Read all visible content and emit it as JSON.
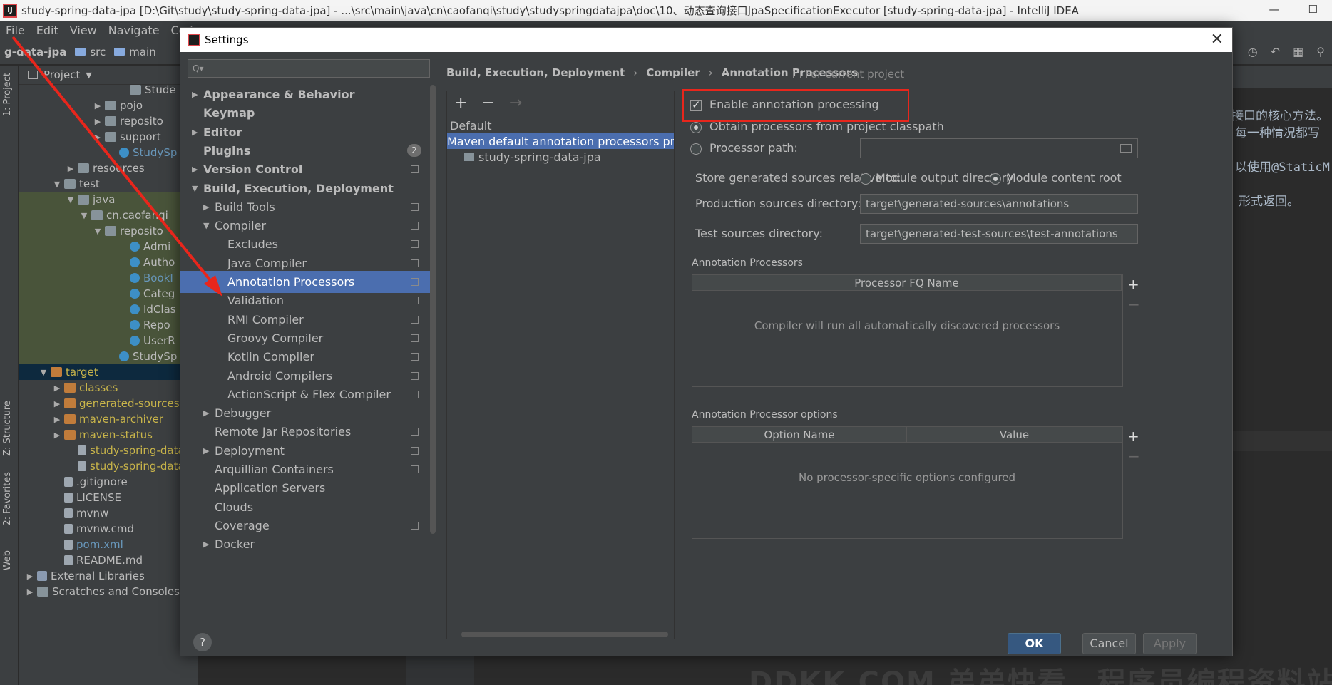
{
  "window": {
    "title": "study-spring-data-jpa [D:\\Git\\study\\study-spring-data-jpa] - ...\\src\\main\\java\\cn\\caofanqi\\study\\studyspringdatajpa\\doc\\10、动态查询接口JpaSpecificationExecutor [study-spring-data-jpa] - IntelliJ IDEA"
  },
  "menu": [
    "File",
    "Edit",
    "View",
    "Navigate",
    "Cod"
  ],
  "navbar": {
    "project": "g-data-jpa",
    "crumbs": [
      "src",
      "main"
    ]
  },
  "left_tools": [
    "1: Project",
    "Z: Structure",
    "2: Favorites",
    "Web"
  ],
  "project_panel": {
    "title": "Project",
    "rows": [
      {
        "label": "Stude",
        "indent": 130,
        "icon": "folder",
        "arrow": ""
      },
      {
        "label": "pojo",
        "indent": 95,
        "icon": "folder",
        "arrow": "▶"
      },
      {
        "label": "reposito",
        "indent": 95,
        "icon": "folder",
        "arrow": "▶"
      },
      {
        "label": "support",
        "indent": 95,
        "icon": "folder",
        "arrow": "▶"
      },
      {
        "label": "StudySp",
        "indent": 115,
        "icon": "jcls",
        "arrow": "",
        "style": "blue"
      },
      {
        "label": "resources",
        "indent": 57,
        "icon": "folder",
        "arrow": "▶"
      },
      {
        "label": "test",
        "indent": 38,
        "icon": "folder",
        "arrow": "▼"
      },
      {
        "label": "java",
        "indent": 57,
        "icon": "folder",
        "arrow": "▼",
        "style": "green"
      },
      {
        "label": "cn.caofanqi",
        "indent": 76,
        "icon": "folder",
        "arrow": "▼",
        "style": "green"
      },
      {
        "label": "reposito",
        "indent": 95,
        "icon": "folder",
        "arrow": "▼",
        "style": "green"
      },
      {
        "label": "Admi",
        "indent": 130,
        "icon": "jcls",
        "arrow": "",
        "style": "green"
      },
      {
        "label": "Autho",
        "indent": 130,
        "icon": "jcls",
        "arrow": "",
        "style": "green"
      },
      {
        "label": "BookI",
        "indent": 130,
        "icon": "jcls",
        "arrow": "",
        "style": "greenblue"
      },
      {
        "label": "Categ",
        "indent": 130,
        "icon": "jcls",
        "arrow": "",
        "style": "green"
      },
      {
        "label": "IdClas",
        "indent": 130,
        "icon": "jcls",
        "arrow": "",
        "style": "green"
      },
      {
        "label": "Repo",
        "indent": 130,
        "icon": "jcls",
        "arrow": "",
        "style": "green"
      },
      {
        "label": "UserR",
        "indent": 130,
        "icon": "jcls",
        "arrow": "",
        "style": "green"
      },
      {
        "label": "StudySp",
        "indent": 115,
        "icon": "jcls",
        "arrow": "",
        "style": "green"
      },
      {
        "label": "target",
        "indent": 19,
        "icon": "ofolder",
        "arrow": "▼",
        "style": "sel"
      },
      {
        "label": "classes",
        "indent": 38,
        "icon": "ofolder",
        "arrow": "▶",
        "style": "yellow"
      },
      {
        "label": "generated-sources",
        "indent": 38,
        "icon": "ofolder",
        "arrow": "▶",
        "style": "yellow"
      },
      {
        "label": "maven-archiver",
        "indent": 38,
        "icon": "ofolder",
        "arrow": "▶",
        "style": "yellow"
      },
      {
        "label": "maven-status",
        "indent": 38,
        "icon": "ofolder",
        "arrow": "▶",
        "style": "yellow"
      },
      {
        "label": "study-spring-data",
        "indent": 57,
        "icon": "file",
        "arrow": "",
        "style": "yellow"
      },
      {
        "label": "study-spring-data",
        "indent": 57,
        "icon": "file",
        "arrow": "",
        "style": "yellow"
      },
      {
        "label": ".gitignore",
        "indent": 38,
        "icon": "file",
        "arrow": ""
      },
      {
        "label": "LICENSE",
        "indent": 38,
        "icon": "file",
        "arrow": ""
      },
      {
        "label": "mvnw",
        "indent": 38,
        "icon": "file",
        "arrow": ""
      },
      {
        "label": "mvnw.cmd",
        "indent": 38,
        "icon": "file",
        "arrow": ""
      },
      {
        "label": "pom.xml",
        "indent": 38,
        "icon": "file",
        "arrow": "",
        "style": "blue"
      },
      {
        "label": "README.md",
        "indent": 38,
        "icon": "file",
        "arrow": ""
      },
      {
        "label": "External Libraries",
        "indent": 0,
        "icon": "lib",
        "arrow": "▶"
      },
      {
        "label": "Scratches and Consoles",
        "indent": 0,
        "icon": "folder",
        "arrow": "▶"
      }
    ]
  },
  "editor_text": [
    "接口的核心方法。",
    "每一种情况都写",
    "以使用@StaticM",
    "形式返回。"
  ],
  "watermark": "DDKK.COM 弟弟快看，程序员编程资料站",
  "dialog": {
    "title": "Settings",
    "search_placeholder": "Q▾",
    "nav": [
      {
        "label": "Appearance & Behavior",
        "level": 0,
        "arrow": "▶",
        "bold": true
      },
      {
        "label": "Keymap",
        "level": 0,
        "arrow": "",
        "bold": true
      },
      {
        "label": "Editor",
        "level": 0,
        "arrow": "▶",
        "bold": true
      },
      {
        "label": "Plugins",
        "level": 0,
        "arrow": "",
        "bold": true,
        "badge": "2"
      },
      {
        "label": "Version Control",
        "level": 0,
        "arrow": "▶",
        "bold": true,
        "copy": true
      },
      {
        "label": "Build, Execution, Deployment",
        "level": 0,
        "arrow": "▼",
        "bold": true
      },
      {
        "label": "Build Tools",
        "level": 1,
        "arrow": "▶",
        "copy": true
      },
      {
        "label": "Compiler",
        "level": 1,
        "arrow": "▼",
        "copy": true
      },
      {
        "label": "Excludes",
        "level": 2,
        "arrow": "",
        "copy": true
      },
      {
        "label": "Java Compiler",
        "level": 2,
        "arrow": "",
        "copy": true
      },
      {
        "label": "Annotation Processors",
        "level": 2,
        "arrow": "",
        "copy": true,
        "selected": true
      },
      {
        "label": "Validation",
        "level": 2,
        "arrow": "",
        "copy": true
      },
      {
        "label": "RMI Compiler",
        "level": 2,
        "arrow": "",
        "copy": true
      },
      {
        "label": "Groovy Compiler",
        "level": 2,
        "arrow": "",
        "copy": true
      },
      {
        "label": "Kotlin Compiler",
        "level": 2,
        "arrow": "",
        "copy": true
      },
      {
        "label": "Android Compilers",
        "level": 2,
        "arrow": "",
        "copy": true
      },
      {
        "label": "ActionScript & Flex Compiler",
        "level": 2,
        "arrow": "",
        "copy": true
      },
      {
        "label": "Debugger",
        "level": 1,
        "arrow": "▶"
      },
      {
        "label": "Remote Jar Repositories",
        "level": 1,
        "arrow": "",
        "copy": true
      },
      {
        "label": "Deployment",
        "level": 1,
        "arrow": "▶",
        "copy": true
      },
      {
        "label": "Arquillian Containers",
        "level": 1,
        "arrow": "",
        "copy": true
      },
      {
        "label": "Application Servers",
        "level": 1,
        "arrow": ""
      },
      {
        "label": "Clouds",
        "level": 1,
        "arrow": ""
      },
      {
        "label": "Coverage",
        "level": 1,
        "arrow": "",
        "copy": true
      },
      {
        "label": "Docker",
        "level": 1,
        "arrow": "▶"
      }
    ],
    "breadcrumb": [
      "Build, Execution, Deployment",
      "Compiler",
      "Annotation Processors"
    ],
    "for_current_project": "For current project",
    "profiles": {
      "add": "+",
      "remove": "−",
      "move": "→",
      "items": [
        {
          "label": "Default",
          "indent": 4,
          "selected": false
        },
        {
          "label": "Maven default annotation processors profile",
          "indent": 4,
          "selected": true
        },
        {
          "label": "study-spring-data-jpa",
          "indent": 24,
          "selected": false,
          "icon": true
        }
      ]
    },
    "enable_annotation_processing": "Enable annotation processing",
    "obtain_from_classpath": "Obtain processors from project classpath",
    "processor_path": "Processor path:",
    "processor_path_value": "",
    "store_generated_label": "Store generated sources relative to:",
    "module_output_directory": "Module output directory",
    "module_content_root": "Module content root",
    "production_sources_label": "Production sources directory:",
    "production_sources_value": "target\\generated-sources\\annotations",
    "test_sources_label": "Test sources directory:",
    "test_sources_value": "target\\generated-test-sources\\test-annotations",
    "annotation_processors_group": "Annotation Processors",
    "processor_fq_name": "Processor FQ Name",
    "processors_empty": "Compiler will run all automatically discovered processors",
    "options_group": "Annotation Processor options",
    "option_name": "Option Name",
    "value": "Value",
    "options_empty": "No processor-specific options configured",
    "help": "?",
    "ok": "OK",
    "cancel": "Cancel",
    "apply": "Apply"
  },
  "colors": {
    "highlight_box": "#e8261c",
    "selection": "#4b6eaf",
    "primary_button": "#365880"
  }
}
